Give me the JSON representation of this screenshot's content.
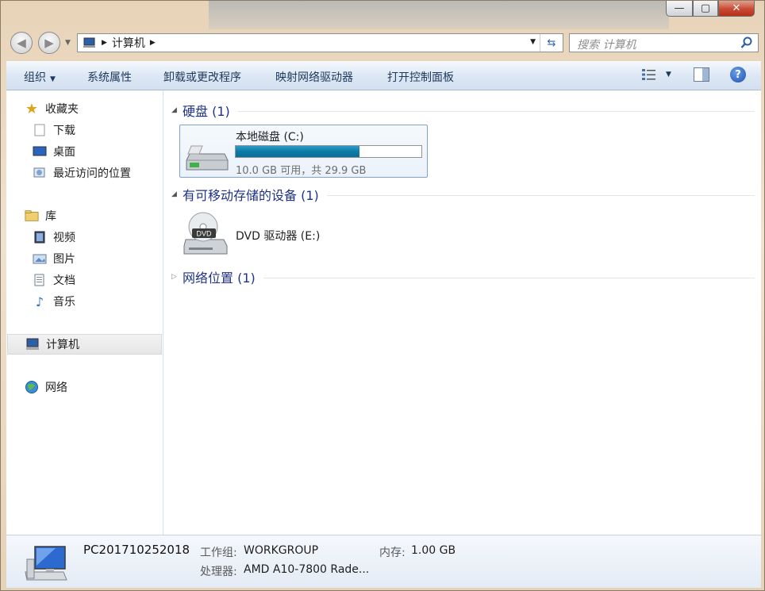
{
  "window": {
    "caption": {
      "minimize": "—",
      "maximize": "▢",
      "close": "✕"
    }
  },
  "nav": {
    "back_icon": "back-arrow-icon",
    "forward_icon": "forward-arrow-icon",
    "address": {
      "crumb": "计算机"
    },
    "search_placeholder": "搜索 计算机"
  },
  "toolbar": {
    "organize": "组织",
    "system_properties": "系统属性",
    "uninstall": "卸载或更改程序",
    "map_drive": "映射网络驱动器",
    "control_panel": "打开控制面板",
    "help_glyph": "?"
  },
  "sidebar": {
    "favorites": {
      "label": "收藏夹",
      "items": [
        {
          "label": "下载"
        },
        {
          "label": "桌面"
        },
        {
          "label": "最近访问的位置"
        }
      ]
    },
    "libraries": {
      "label": "库",
      "items": [
        {
          "label": "视频"
        },
        {
          "label": "图片"
        },
        {
          "label": "文档"
        },
        {
          "label": "音乐"
        }
      ]
    },
    "computer": {
      "label": "计算机"
    },
    "network": {
      "label": "网络"
    }
  },
  "content": {
    "hard_disks": {
      "title": "硬盘 (1)",
      "drive": {
        "name": "本地磁盘 (C:)",
        "free_text": "10.0 GB 可用，共 29.9 GB",
        "used_fraction": 0.666
      }
    },
    "removable": {
      "title": "有可移动存储的设备 (1)",
      "drive": {
        "name": "DVD 驱动器 (E:)",
        "icon_label": "DVD"
      }
    },
    "network": {
      "title": "网络位置 (1)"
    }
  },
  "details": {
    "pc_name": "PC201710252018",
    "workgroup_label": "工作组:",
    "workgroup_value": "WORKGROUP",
    "memory_label": "内存:",
    "memory_value": "1.00 GB",
    "cpu_label": "处理器:",
    "cpu_value": "AMD A10-7800 Rade..."
  },
  "colors": {
    "accent": "#1e3287",
    "progress": "#0d7aa6",
    "toolbar_text": "#1e395b"
  }
}
